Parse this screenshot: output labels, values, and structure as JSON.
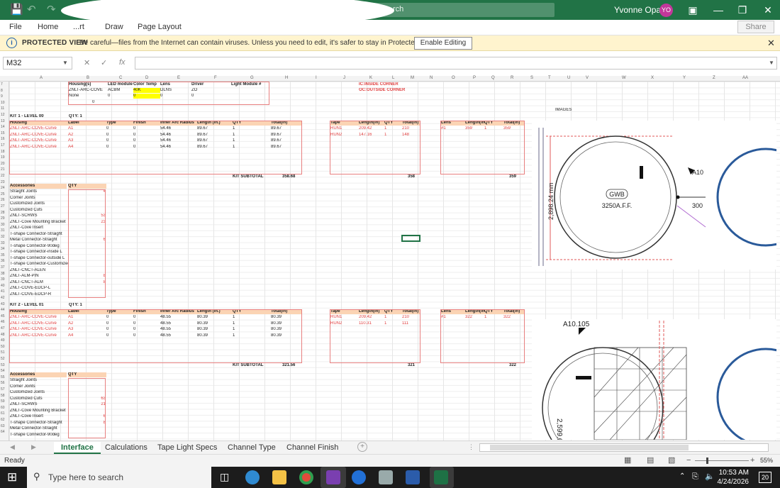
{
  "titlebar": {
    "search_text": "rch",
    "user_name": "Yvonne Opara",
    "user_initials": "YO",
    "bg": "#217346"
  },
  "menu": {
    "items": [
      "File",
      "Home",
      "Draw"
    ],
    "insert_partial": "...rt",
    "page_layout_partial": "Page Layout",
    "share": "Share"
  },
  "protected_view": {
    "title": "PROTECTED VIEW",
    "message": "Be careful—files from the Internet can contain viruses. Unless you need to edit, it's safer to stay in Protected View.",
    "button": "Enable Editing"
  },
  "formula_bar": {
    "name_box": "M32",
    "fx": "fx",
    "formula": ""
  },
  "columns": [
    "A",
    "B",
    "C",
    "D",
    "E",
    "F",
    "G",
    "H",
    "I",
    "J",
    "K",
    "L",
    "M",
    "N",
    "O",
    "P",
    "Q",
    "R",
    "S",
    "T",
    "U",
    "V",
    "W",
    "X",
    "Y",
    "Z",
    "AA"
  ],
  "top_section": {
    "headers": [
      "Housing(s)",
      "LED module",
      "Color Temp",
      "Lens",
      "Driver",
      "Light Module #"
    ],
    "row8": [
      "ZNLT-ARC-COVE",
      "ACBM",
      "40K",
      "DLNS",
      "ZO"
    ],
    "row9": [
      "None",
      "0",
      "0",
      "0",
      "0"
    ],
    "row10_val": "0",
    "notes": [
      "IC:INSIDE CORNER",
      "OC:OUTSIDE CORNER"
    ],
    "images_label": "IMAGES"
  },
  "kits": [
    {
      "title": "KIT 1 - LEVEL 00",
      "qty_label": "QTY: 1",
      "table_headers": [
        "Housing",
        "Label",
        "Type",
        "Finish",
        "Inner Arc Radius",
        "Length (in.)",
        "QTY",
        "Total(in)"
      ],
      "rows": [
        [
          "ZNLT-ARC-COVE-Curve",
          "A1",
          "0",
          "0",
          "54.46",
          "89.67",
          "1",
          "89.67"
        ],
        [
          "ZNLT-ARC-COVE-Curve",
          "A2",
          "0",
          "0",
          "54.46",
          "89.67",
          "1",
          "89.67"
        ],
        [
          "ZNLT-ARC-COVE-Curve",
          "A3",
          "0",
          "0",
          "54.46",
          "89.67",
          "1",
          "89.67"
        ],
        [
          "ZNLT-ARC-COVE-Curve",
          "A4",
          "0",
          "0",
          "54.46",
          "89.67",
          "1",
          "89.67"
        ]
      ],
      "subtotal_label": "KIT SUBTOTAL",
      "subtotal": "358.68",
      "tape_headers": [
        "Tape",
        "Length(in)",
        "QTY",
        "Total(in)"
      ],
      "tape_rows": [
        [
          "RUN1",
          "209.42",
          "1",
          "210"
        ],
        [
          "RUN2",
          "147.16",
          "1",
          "148"
        ]
      ],
      "tape_total": "358",
      "lens_headers": [
        "Lens",
        "Length(in)",
        "QTY",
        "Total(in)"
      ],
      "lens_rows": [
        [
          "#1",
          "359",
          "1",
          "359"
        ]
      ],
      "lens_total": "359",
      "accessories": [
        "Straight Joints",
        "Corner Joints",
        "Customized Joints",
        "Customized Cuts",
        "ZNLT-SCRWS",
        "ZNLT-Cove Mounting Bracket",
        "ZNLT-Cove Insert",
        "T-shape Connector-Straight",
        "Metal Connector-Straight",
        "T-shape Connector-90deg",
        "T-shape Connector-inside L",
        "T-shape Connector-outside L",
        "T-shape Connector-Customized",
        "ZNLT-CNCT-ALEN",
        "ZNLT-ALM-PIN",
        "ZNLT-CNCT-ALM",
        "ZNLT-COVE-EDCP-L",
        "ZNLT-COVE-EDCP-R"
      ],
      "acc_qty": [
        "4",
        "",
        "",
        "",
        "53",
        "23",
        "",
        "",
        "6",
        "",
        "",
        "",
        "",
        "",
        "8",
        "8",
        "",
        ""
      ]
    },
    {
      "title": "KIT 2 - LEVEL 01",
      "qty_label": "QTY: 1",
      "table_headers": [
        "Housing",
        "Label",
        "Type",
        "Finish",
        "Inner Arc Radius",
        "Length (in.)",
        "QTY",
        "Total(in)"
      ],
      "rows": [
        [
          "ZNLT-ARC-COVE-Curve",
          "A1",
          "0",
          "0",
          "48.55",
          "80.39",
          "1",
          "80.39"
        ],
        [
          "ZNLT-ARC-COVE-Curve",
          "A2",
          "0",
          "0",
          "48.55",
          "80.39",
          "1",
          "80.39"
        ],
        [
          "ZNLT-ARC-COVE-Curve",
          "A3",
          "0",
          "0",
          "48.55",
          "80.39",
          "1",
          "80.39"
        ],
        [
          "ZNLT-ARC-COVE-Curve",
          "A4",
          "0",
          "0",
          "48.55",
          "80.39",
          "1",
          "80.39"
        ]
      ],
      "subtotal_label": "KIT SUBTOTAL",
      "subtotal": "321.56",
      "tape_headers": [
        "Tape",
        "Length(in)",
        "QTY",
        "Total(in)"
      ],
      "tape_rows": [
        [
          "RUN1",
          "209.42",
          "1",
          "210"
        ],
        [
          "RUN2",
          "110.31",
          "1",
          "111"
        ]
      ],
      "tape_total": "321",
      "lens_headers": [
        "Lens",
        "Length(in)",
        "QTY",
        "Total(in)"
      ],
      "lens_rows": [
        [
          "#1",
          "322",
          "1",
          "322"
        ]
      ],
      "lens_total": "322",
      "accessories": [
        "Straight Joints",
        "Corner Joints",
        "Customized Joints",
        "Customized Cuts",
        "ZNLT-SCRWS",
        "ZNLT-Cove Mounting Bracket",
        "ZNLT-Cove Insert",
        "T-shape Connector-Straight",
        "Metal Connector-Straight",
        "T-shape Connector-90deg"
      ],
      "acc_qty": [
        "",
        "",
        "",
        "63",
        "21",
        "",
        "6",
        "8",
        "",
        ""
      ]
    }
  ],
  "accessories_header": [
    "Accessories",
    "QTY"
  ],
  "drawing1": {
    "dim": "2,898.24 mm",
    "label1": "GWB",
    "label2": "3250A.F.F.",
    "tag": "A10",
    "label3": "300"
  },
  "drawing2": {
    "dim": "2,599.65 mm",
    "tag": "A10.105"
  },
  "sheet_tabs": [
    "Interface",
    "Calculations",
    "Tape Light Specs",
    "Channel Type",
    "Channel Finish"
  ],
  "active_tab": "Interface",
  "status": {
    "ready": "Ready",
    "zoom": "55%"
  },
  "taskbar": {
    "search_placeholder": "Type here to search",
    "time": "10:53 AM",
    "date": "4/24/2026",
    "notif": "20"
  }
}
